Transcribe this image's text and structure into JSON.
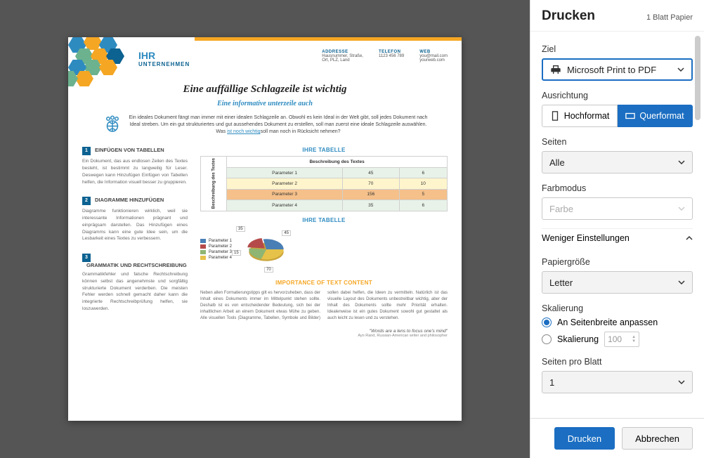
{
  "sidebar": {
    "title": "Drucken",
    "sheets": "1 Blatt Papier",
    "print_btn": "Drucken",
    "cancel_btn": "Abbrechen",
    "ziel": {
      "label": "Ziel",
      "value": "Microsoft Print to PDF"
    },
    "ausrichtung": {
      "label": "Ausrichtung",
      "hoch": "Hochformat",
      "quer": "Querformat"
    },
    "seiten": {
      "label": "Seiten",
      "value": "Alle"
    },
    "farbmodus": {
      "label": "Farbmodus",
      "value": "Farbe"
    },
    "settings_toggle": "Weniger Einstellungen",
    "papier": {
      "label": "Papiergröße",
      "value": "Letter"
    },
    "skalierung": {
      "label": "Skalierung",
      "fit": "An Seitenbreite anpassen",
      "scale": "Skalierung",
      "value": "100"
    },
    "spb": {
      "label": "Seiten pro Blatt",
      "value": "1"
    }
  },
  "doc": {
    "brand": "IHR",
    "brand_sub": "UNTERNEHMEN",
    "contact": {
      "addr_lbl": "ADDRESSE",
      "addr_val": "Hausnummer, Straße,\nOrt, PLZ, Land",
      "tel_lbl": "TELEFON",
      "tel_val": "1123 456 789",
      "web_lbl": "WEB",
      "web_val": "you@mail.com\nyourweb.com"
    },
    "headline": "Eine auffällige Schlagzeile ist wichtig",
    "subhead": "Eine informative unterzeile auch",
    "intro": "Ein ideales Dokument fängt man immer mit einer idealen Schlagzeile an. Obwohl es kein Ideal in der Welt gibt, soll jedes Dokument nach Ideal streben. Um ein gut strukturiertes und gut aussehendes Dokument zu erstellen, soll man zuerst eine ideale Schlagzeile auswählen. Was ",
    "intro_link": "ist noch wichtig",
    "intro_tail": "soll man noch in Rücksicht nehmen?",
    "sections": [
      {
        "num": "1",
        "title": "EINFÜGEN VON TABELLEN",
        "text": "Ein Dokument, das aus endlosen Zeilen des Textes besteht, ist bestimmt zu langweilig für Leser. Deswegen kann Hinzufügen Einfügen von Tabellen helfen, die Information visuell besser zu gruppieren."
      },
      {
        "num": "2",
        "title": "DIAGRAMME HINZUFÜGEN",
        "text": "Diagramme funktionieren wirklich, weil sie interessante Informationen prägnant und einprägsam darstellen. Das Hinzufügen eines Diagramms kann eine gute Idee sein, um die Lesbarkeit eines Textes zu verbessern."
      },
      {
        "num": "3",
        "title": "GRAMMATIK UND RECHTSCHREIBUNG",
        "text": "Grammatikfehler und falsche Rechtschreibung können selbst das angenehmste und sorgfältig strukturierte Dokument verderben. Die meisten Fehler werden schnell gemacht daher kann die integrierte Rechtschreibprüfung helfen, sie loszuwerden."
      }
    ],
    "table": {
      "title": "IHRE TABELLE",
      "side": "Beschreibung\ndes Textes",
      "header": "Beschreibung des Textes",
      "rows": [
        [
          "Parameter 1",
          "45",
          "6"
        ],
        [
          "Parameter 2",
          "70",
          "10"
        ],
        [
          "Parameter 3",
          "156",
          "5"
        ],
        [
          "Parameter 4",
          "35",
          "6"
        ]
      ]
    },
    "pie": {
      "title": "IHRE TABELLE",
      "legend": [
        "Parameter 1",
        "Parameter 2",
        "Parameter 3",
        "Parameter 4"
      ],
      "callouts": [
        "35",
        "45",
        "15",
        "70"
      ],
      "colors": [
        "#4A7FB5",
        "#B54A4A",
        "#8FB573",
        "#E6C24A"
      ]
    },
    "importance": {
      "title": "IMPORTANCE OF TEXT CONTENT",
      "text": "Neben allen Formatierungstipps gilt es hervorzuheben, dass der Inhalt eines Dokuments immer im Mittelpunkt stehen sollte. Deshalb ist es von entscheidender Bedeutung, sich bei der inhaltlichen Arbeit an einem Dokument etwas Mühe zu geben. Alle visuellen Tools (Diagramme, Tabellen, Symbole und Bilder) sollen dabei helfen, die Ideen zu vermitteln. Natürlich ist das visuelle Layout des Dokuments unbestreitbar wichtig, aber der Inhalt des Dokuments sollte mehr Priorität erhalten. Idealerweise ist ein gutes Dokument sowohl gut gestaltet als auch leicht zu lesen und zu verstehen."
    },
    "quote": "\"Words are a lens to focus one's mind\"",
    "quote_attr": "Ayn Rand, Russian-American writer and philosopher"
  }
}
